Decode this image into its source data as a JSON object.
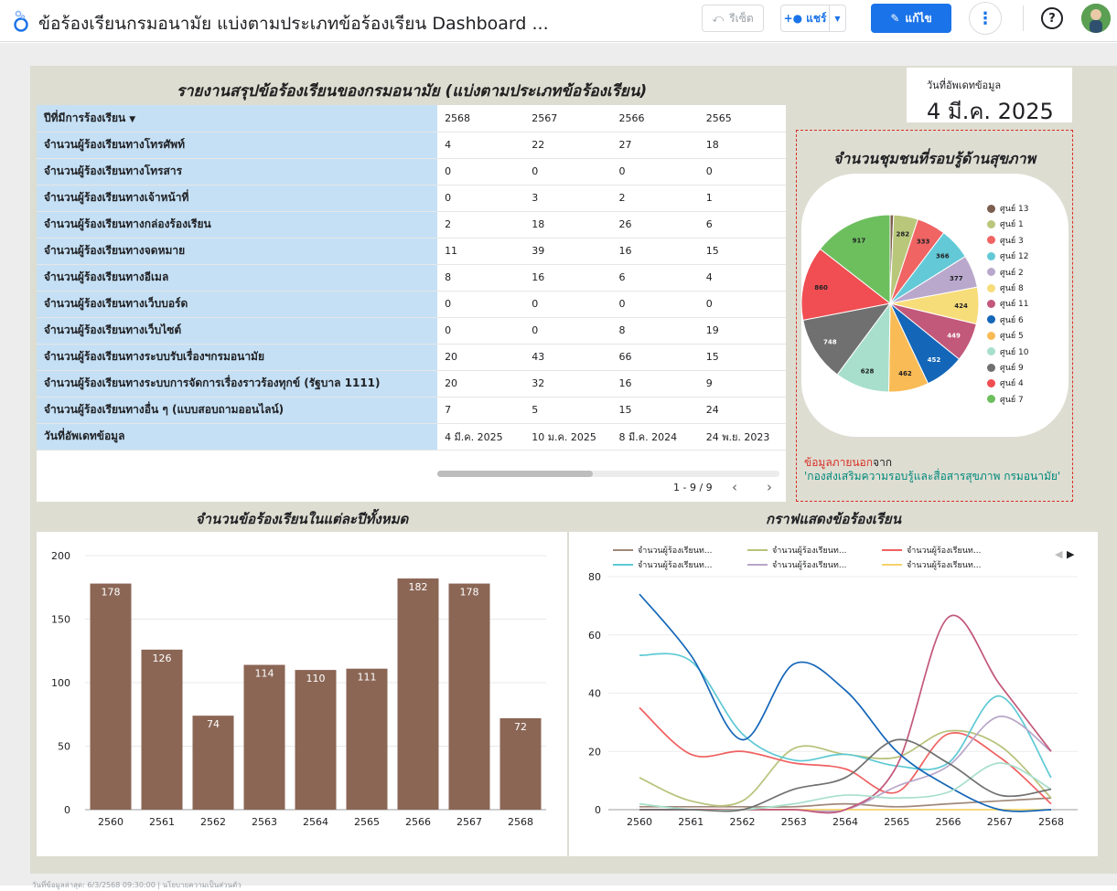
{
  "app": {
    "title": "ข้อร้องเรียนกรมอนามัย แบ่งตามประเภทข้อร้องเรียน Dashboard ...",
    "reset_label": "รีเซ็ต",
    "share_label": "แชร์",
    "edit_label": "แก้ไข",
    "more_label": "⋮",
    "help_label": "?"
  },
  "table": {
    "title": "รายงานสรุปข้อร้องเรียนของกรมอนามัย (แบ่งตามประเภทข้อร้องเรียน)",
    "header_label": "ปีที่มีการร้องเรียน",
    "years": [
      "2568",
      "2567",
      "2566",
      "2565"
    ],
    "rows": [
      {
        "label": "จำนวนผู้ร้องเรียนทางโทรศัพท์",
        "values": [
          "4",
          "22",
          "27",
          "18"
        ]
      },
      {
        "label": "จำนวนผู้ร้องเรียนทางโทรสาร",
        "values": [
          "0",
          "0",
          "0",
          "0"
        ]
      },
      {
        "label": "จำนวนผู้ร้องเรียนทางเจ้าหน้าที่",
        "values": [
          "0",
          "3",
          "2",
          "1"
        ]
      },
      {
        "label": "จำนวนผู้ร้องเรียนทางกล่องร้องเรียน",
        "values": [
          "2",
          "18",
          "26",
          "6"
        ]
      },
      {
        "label": "จำนวนผู้ร้องเรียนทางจดหมาย",
        "values": [
          "11",
          "39",
          "16",
          "15"
        ]
      },
      {
        "label": "จำนวนผู้ร้องเรียนทางอีเมล",
        "values": [
          "8",
          "16",
          "6",
          "4"
        ]
      },
      {
        "label": "จำนวนผู้ร้องเรียนทางเว็บบอร์ด",
        "values": [
          "0",
          "0",
          "0",
          "0"
        ]
      },
      {
        "label": "จำนวนผู้ร้องเรียนทางเว็บไซต์",
        "values": [
          "0",
          "0",
          "8",
          "19"
        ]
      },
      {
        "label": "จำนวนผู้ร้องเรียนทางระบบรับเรื่องฯกรมอนามัย",
        "values": [
          "20",
          "43",
          "66",
          "15"
        ]
      },
      {
        "label": "จำนวนผู้ร้องเรียนทางระบบการจัดการเรื่องราวร้องทุกข์ (รัฐบาล 1111)",
        "values": [
          "20",
          "32",
          "16",
          "9"
        ]
      },
      {
        "label": "จำนวนผู้ร้องเรียนทางอื่น ๆ (แบบสอบถามออนไลน์)",
        "values": [
          "7",
          "5",
          "15",
          "24"
        ]
      },
      {
        "label": "วันที่อัพเดทข้อมูล",
        "values": [
          "4 มี.ค. 2025",
          "10 ม.ค. 2025",
          "8 มี.ค. 2024",
          "24 พ.ย. 2023"
        ]
      }
    ],
    "pagination": "1 - 9 / 9"
  },
  "update": {
    "label": "วันที่อัพเดทข้อมูล",
    "value": "4 มี.ค. 2025"
  },
  "pie": {
    "title": "จำนวนชุมชนที่รอบรู้ด้านสุขภาพ",
    "source_prefix_red": "ข้อมูลภายนอก",
    "source_prefix": "จาก",
    "source_link": "'กองส่งเสริมความรอบรู้และสื่อสารสุขภาพ กรมอนามัย'"
  },
  "bar_chart": {
    "title": "จำนวนข้อร้องเรียนในแต่ละปีทั้งหมด",
    "color": "#8b6655"
  },
  "line_chart": {
    "title": "กราฟแสดงข้อร้องเรียน",
    "legend": [
      {
        "name": "จำนวนผู้ร้องเรียนท...",
        "color": "#a0887a"
      },
      {
        "name": "จำนวนผู้ร้องเรียนท...",
        "color": "#b8c27a"
      },
      {
        "name": "จำนวนผู้ร้องเรียนท...",
        "color": "#f06060"
      },
      {
        "name": "จำนวนผู้ร้องเรียนท...",
        "color": "#5ec9d4"
      },
      {
        "name": "จำนวนผู้ร้องเรียนท...",
        "color": "#b8a6c9"
      },
      {
        "name": "จำนวนผู้ร้องเรียนท...",
        "color": "#f5d36b"
      }
    ]
  },
  "footer": "วันที่ข้อมูลล่าสุด: 6/3/2568 09:30:00 | นโยบายความเป็นส่วนตัว",
  "chart_data": [
    {
      "type": "pie",
      "title": "จำนวนชุมชนที่รอบรู้ด้านสุขภาพ",
      "legend_position": "right",
      "labels": [
        "ศูนย์ 13",
        "ศูนย์ 1",
        "ศูนย์ 3",
        "ศูนย์ 12",
        "ศูนย์ 2",
        "ศูนย์ 8",
        "ศูนย์ 11",
        "ศูนย์ 6",
        "ศูนย์ 5",
        "ศูนย์ 10",
        "ศูนย์ 9",
        "ศูนย์ 4",
        "ศูนย์ 7"
      ],
      "values": [
        40,
        282,
        333,
        366,
        377,
        424,
        449,
        452,
        462,
        628,
        748,
        860,
        917
      ],
      "colors": [
        "#7b5e4e",
        "#b9c77b",
        "#f06464",
        "#63c9d7",
        "#b9a8cc",
        "#f7dc7a",
        "#c2587a",
        "#1466b8",
        "#f9bb55",
        "#a8dfcc",
        "#707070",
        "#f04e52",
        "#6dbf5e"
      ],
      "data_labels": [
        "",
        "282",
        "333",
        "366",
        "377",
        "424",
        "449",
        "452",
        "462",
        "628",
        "748",
        "860",
        "917"
      ]
    },
    {
      "type": "bar",
      "title": "จำนวนข้อร้องเรียนในแต่ละปีทั้งหมด",
      "categories": [
        "2560",
        "2561",
        "2562",
        "2563",
        "2564",
        "2565",
        "2566",
        "2567",
        "2568"
      ],
      "values": [
        178,
        126,
        74,
        114,
        110,
        111,
        182,
        178,
        72
      ],
      "ylim": [
        0,
        200
      ],
      "yticks": [
        0,
        50,
        100,
        150,
        200
      ],
      "grid": true
    },
    {
      "type": "line",
      "title": "กราฟแสดงข้อร้องเรียน",
      "x": [
        "2560",
        "2561",
        "2562",
        "2563",
        "2564",
        "2565",
        "2566",
        "2567",
        "2568"
      ],
      "ylim": [
        0,
        80
      ],
      "yticks": [
        0,
        20,
        40,
        60,
        80
      ],
      "grid": true,
      "series": [
        {
          "name": "จำนวนผู้ร้องเรียนท...",
          "color": "#a0887a",
          "values": [
            1,
            1,
            1,
            1,
            2,
            1,
            2,
            3,
            4
          ]
        },
        {
          "name": "จำนวนผู้ร้องเรียนท...",
          "color": "#b8c27a",
          "values": [
            11,
            3,
            3,
            21,
            19,
            18,
            27,
            22,
            4
          ]
        },
        {
          "name": "จำนวนผู้ร้องเรียนท...",
          "color": "#f06060",
          "values": [
            35,
            19,
            20,
            16,
            14,
            6,
            26,
            18,
            2
          ]
        },
        {
          "name": "จำนวนผู้ร้องเรียนท...",
          "color": "#5ec9d4",
          "values": [
            53,
            51,
            26,
            17,
            19,
            15,
            16,
            39,
            11
          ]
        },
        {
          "name": "จำนวนผู้ร้องเรียนท...",
          "color": "#b8a6c9",
          "values": [
            0,
            0,
            0,
            0,
            0,
            8,
            15,
            32,
            20
          ]
        },
        {
          "name": "จำนวนผู้ร้องเรียนท...",
          "color": "#f5d36b",
          "values": [
            0,
            0,
            0,
            0,
            0,
            0,
            0,
            0,
            0
          ]
        },
        {
          "color": "#c2587a",
          "values": [
            0,
            0,
            0,
            0,
            0,
            15,
            66,
            43,
            20
          ]
        },
        {
          "color": "#1466b8",
          "values": [
            74,
            53,
            24,
            50,
            41,
            20,
            8,
            0,
            0
          ]
        },
        {
          "color": "#a8dfcc",
          "values": [
            2,
            0,
            0,
            2,
            5,
            4,
            6,
            16,
            7
          ]
        },
        {
          "color": "#707070",
          "values": [
            0,
            0,
            0,
            7,
            11,
            24,
            16,
            5,
            7
          ]
        }
      ]
    }
  ]
}
